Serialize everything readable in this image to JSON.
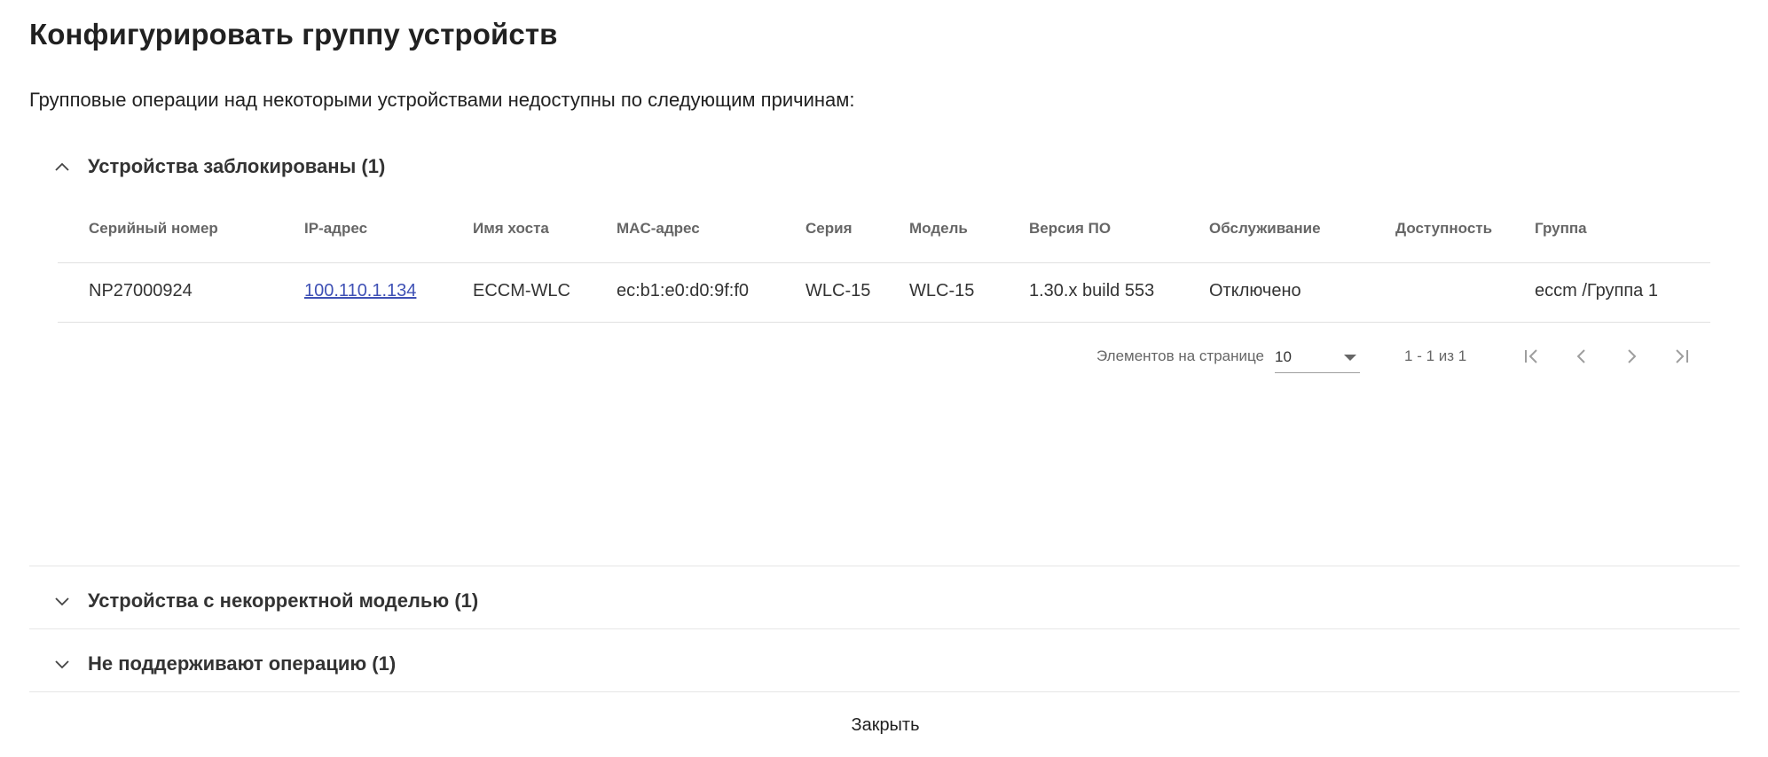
{
  "dialog": {
    "title": "Конфигурировать группу устройств",
    "subtitle": "Групповые операции над некоторыми устройствами недоступны по следующим причинам:",
    "close_label": "Закрыть"
  },
  "panels": [
    {
      "label": "Устройства заблокированы (1)",
      "expanded": true,
      "icon": "chevron-up-icon"
    },
    {
      "label": "Устройства с некорректной моделью (1)",
      "expanded": false,
      "icon": "chevron-down-icon"
    },
    {
      "label": "Не поддерживают операцию (1)",
      "expanded": false,
      "icon": "chevron-down-icon"
    }
  ],
  "table": {
    "columns": [
      "Серийный номер",
      "IP-адрес",
      "Имя хоста",
      "MAC-адрес",
      "Серия",
      "Модель",
      "Версия ПО",
      "Обслуживание",
      "Доступность",
      "Группа"
    ],
    "rows": [
      {
        "serial": "NP27000924",
        "ip": "100.110.1.134",
        "hostname": "ECCM-WLC",
        "mac": "ec:b1:e0:d0:9f:f0",
        "series": "WLC-15",
        "model": "WLC-15",
        "firmware": "1.30.x build 553",
        "maintenance": "Отключено",
        "availability": "",
        "group": "eccm /Группа 1"
      }
    ]
  },
  "paginator": {
    "items_per_page_label": "Элементов на странице",
    "page_size": "10",
    "range_label": "1 - 1 из 1",
    "buttons": [
      "first-page-icon",
      "previous-page-icon",
      "next-page-icon",
      "last-page-icon"
    ]
  },
  "colors": {
    "link": "#3f51b5",
    "text": "#212121",
    "muted": "#666666",
    "divider": "#e0e0e0",
    "icon_disabled": "#9e9e9e"
  }
}
